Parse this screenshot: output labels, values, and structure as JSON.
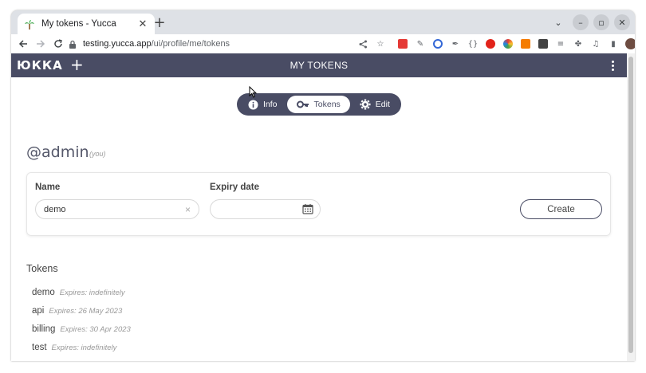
{
  "browser": {
    "tab_title": "My tokens - Yucca",
    "url_host": "testing.yucca.app",
    "url_path": "/ui/profile/me/tokens"
  },
  "app": {
    "logo_text": "ЮККА",
    "page_title": "MY TOKENS"
  },
  "segments": [
    {
      "label": "Info",
      "icon": "info-icon",
      "active": false
    },
    {
      "label": "Tokens",
      "icon": "key-icon",
      "active": true
    },
    {
      "label": "Edit",
      "icon": "gear-icon",
      "active": false
    }
  ],
  "profile": {
    "username": "@admin",
    "you_label": "(you)"
  },
  "form": {
    "name_label": "Name",
    "name_value": "demo",
    "expiry_label": "Expiry date",
    "expiry_value": "",
    "create_label": "Create"
  },
  "tokens": {
    "heading": "Tokens",
    "items": [
      {
        "name": "demo",
        "expires": "Expires: indefinitely"
      },
      {
        "name": "api",
        "expires": "Expires: 26 May 2023"
      },
      {
        "name": "billing",
        "expires": "Expires: 30 Apr 2023"
      },
      {
        "name": "test",
        "expires": "Expires: indefinitely"
      }
    ]
  },
  "colors": {
    "primary": "#494c64",
    "page_bg": "#ffffff"
  }
}
